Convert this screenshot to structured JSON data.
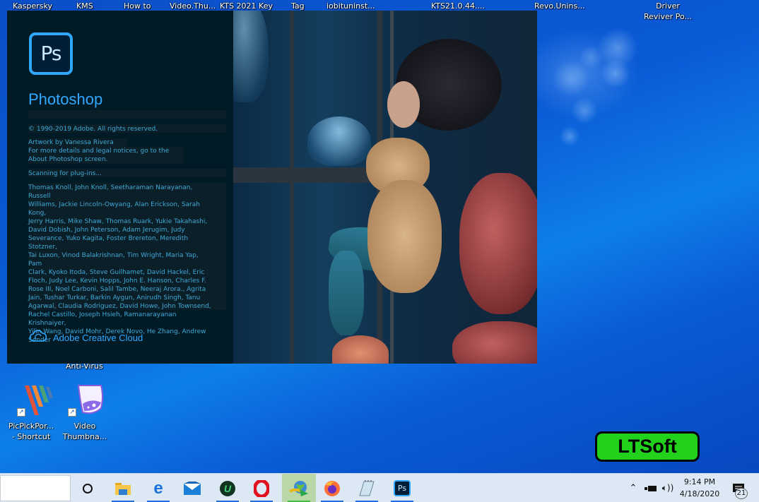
{
  "desktop": {
    "top_icons": [
      {
        "label": "Kaspersky"
      },
      {
        "label": "KMS"
      },
      {
        "label": "How to"
      },
      {
        "label": "Video.Thu..."
      },
      {
        "label": "KTS 2021 Key"
      },
      {
        "label": "Tag"
      },
      {
        "label": "iobituninst..."
      },
      {
        "label": "KTS21.0.44...."
      },
      {
        "label": "Revo.Unins..."
      },
      {
        "label_line1": "Driver",
        "label_line2": "Reviver Po..."
      }
    ],
    "partial_label": "Anti-Virus",
    "icons": [
      {
        "label_line1": "PicPickPor...",
        "label_line2": "- Shortcut",
        "icon": "picpick-icon"
      },
      {
        "label_line1": "Video",
        "label_line2": "Thumbna...",
        "icon": "video-thumbnail-icon"
      }
    ],
    "badge": "LTSoft"
  },
  "splash": {
    "logo_text": "Ps",
    "app_name": "Photoshop",
    "copyright": "© 1990-2019 Adobe. All rights reserved.",
    "artwork_line1": "Artwork by Vanessa Rivera",
    "artwork_line2": "For more details and legal notices, go to the",
    "artwork_line3": "About Photoshop screen.",
    "status": "Scanning for plug-ins...",
    "credits": [
      "Thomas Knoll, John Knoll, Seetharaman Narayanan, Russell",
      "Williams, Jackie Lincoln-Owyang, Alan Erickson, Sarah Kong,",
      "Jerry Harris, Mike Shaw, Thomas Ruark, Yukie Takahashi,",
      "David Dobish, John Peterson, Adam Jerugim, Judy",
      "Severance, Yuko Kagita, Foster Brereton, Meredith Stotzner,",
      "Tai Luxon, Vinod Balakrishnan, Tim Wright, Maria Yap, Pam",
      "Clark, Kyoko Itoda, Steve Guilhamet, David Hackel, Eric",
      "Floch, Judy Lee, Kevin Hopps, John E. Hanson, Charles F.",
      "Rose III, Noel Carboni, Salil Tambe, Neeraj Arora., Agrita",
      "Jain, Tushar Turkar, Barkin Aygun, Anirudh Singh, Tanu",
      "Agarwal, Claudia Rodriguez, David Howe, John Townsend,",
      "Rachel Castillo, Joseph Hsieh, Ramanarayanan Krishnaiyer,",
      "Yilin Wang, David Mohr, Derek Novo, He Zhang, Andrew",
      "Sender"
    ],
    "brand": "Adobe Creative Cloud"
  },
  "taskbar": {
    "apps": [
      {
        "name": "cortana-button",
        "icon": "circle"
      },
      {
        "name": "file-explorer",
        "icon": "folder"
      },
      {
        "name": "edge",
        "icon": "e"
      },
      {
        "name": "mail",
        "icon": "envelope"
      },
      {
        "name": "ultraviewer",
        "icon": "U"
      },
      {
        "name": "opera",
        "icon": "O"
      },
      {
        "name": "internet-download-manager",
        "icon": "globe"
      },
      {
        "name": "firefox",
        "icon": "fox"
      },
      {
        "name": "notepad",
        "icon": "notepad"
      },
      {
        "name": "photoshop",
        "icon": "Ps"
      }
    ],
    "time": "9:14 PM",
    "date": "4/18/2020",
    "notification_count": "21"
  }
}
